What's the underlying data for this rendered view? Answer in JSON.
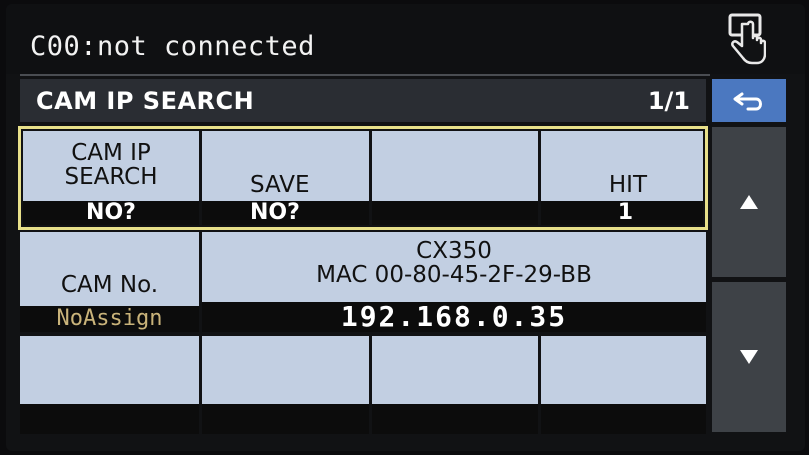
{
  "status": {
    "text": "C00:not connected",
    "icon": "touch-hand-icon"
  },
  "header": {
    "title": "CAM IP SEARCH",
    "page": "1/1"
  },
  "nav": {
    "back_icon": "back-arrow-icon",
    "up_icon": "up-triangle-icon",
    "down_icon": "down-triangle-icon"
  },
  "row1": {
    "cam_ip_search": {
      "label": "CAM IP\nSEARCH",
      "value": "NO?"
    },
    "save": {
      "label": "SAVE",
      "value": "NO?"
    },
    "empty": {
      "label": "",
      "value": ""
    },
    "hit": {
      "label": "HIT",
      "value": "1"
    }
  },
  "row2": {
    "cam_no": {
      "label": "CAM No.",
      "value": "NoAssign"
    },
    "camera": {
      "model": "CX350",
      "mac": "MAC 00-80-45-2F-29-BB",
      "ip": "192.168.0.35"
    }
  },
  "row3": {
    "cells": [
      "",
      "",
      "",
      ""
    ]
  },
  "colors": {
    "cell_bg": "#c2cfe2",
    "value_bg": "#0c0c0c",
    "highlight": "#e8e08a",
    "noassign": "#c9b37a",
    "back_btn": "#4b78c0"
  }
}
